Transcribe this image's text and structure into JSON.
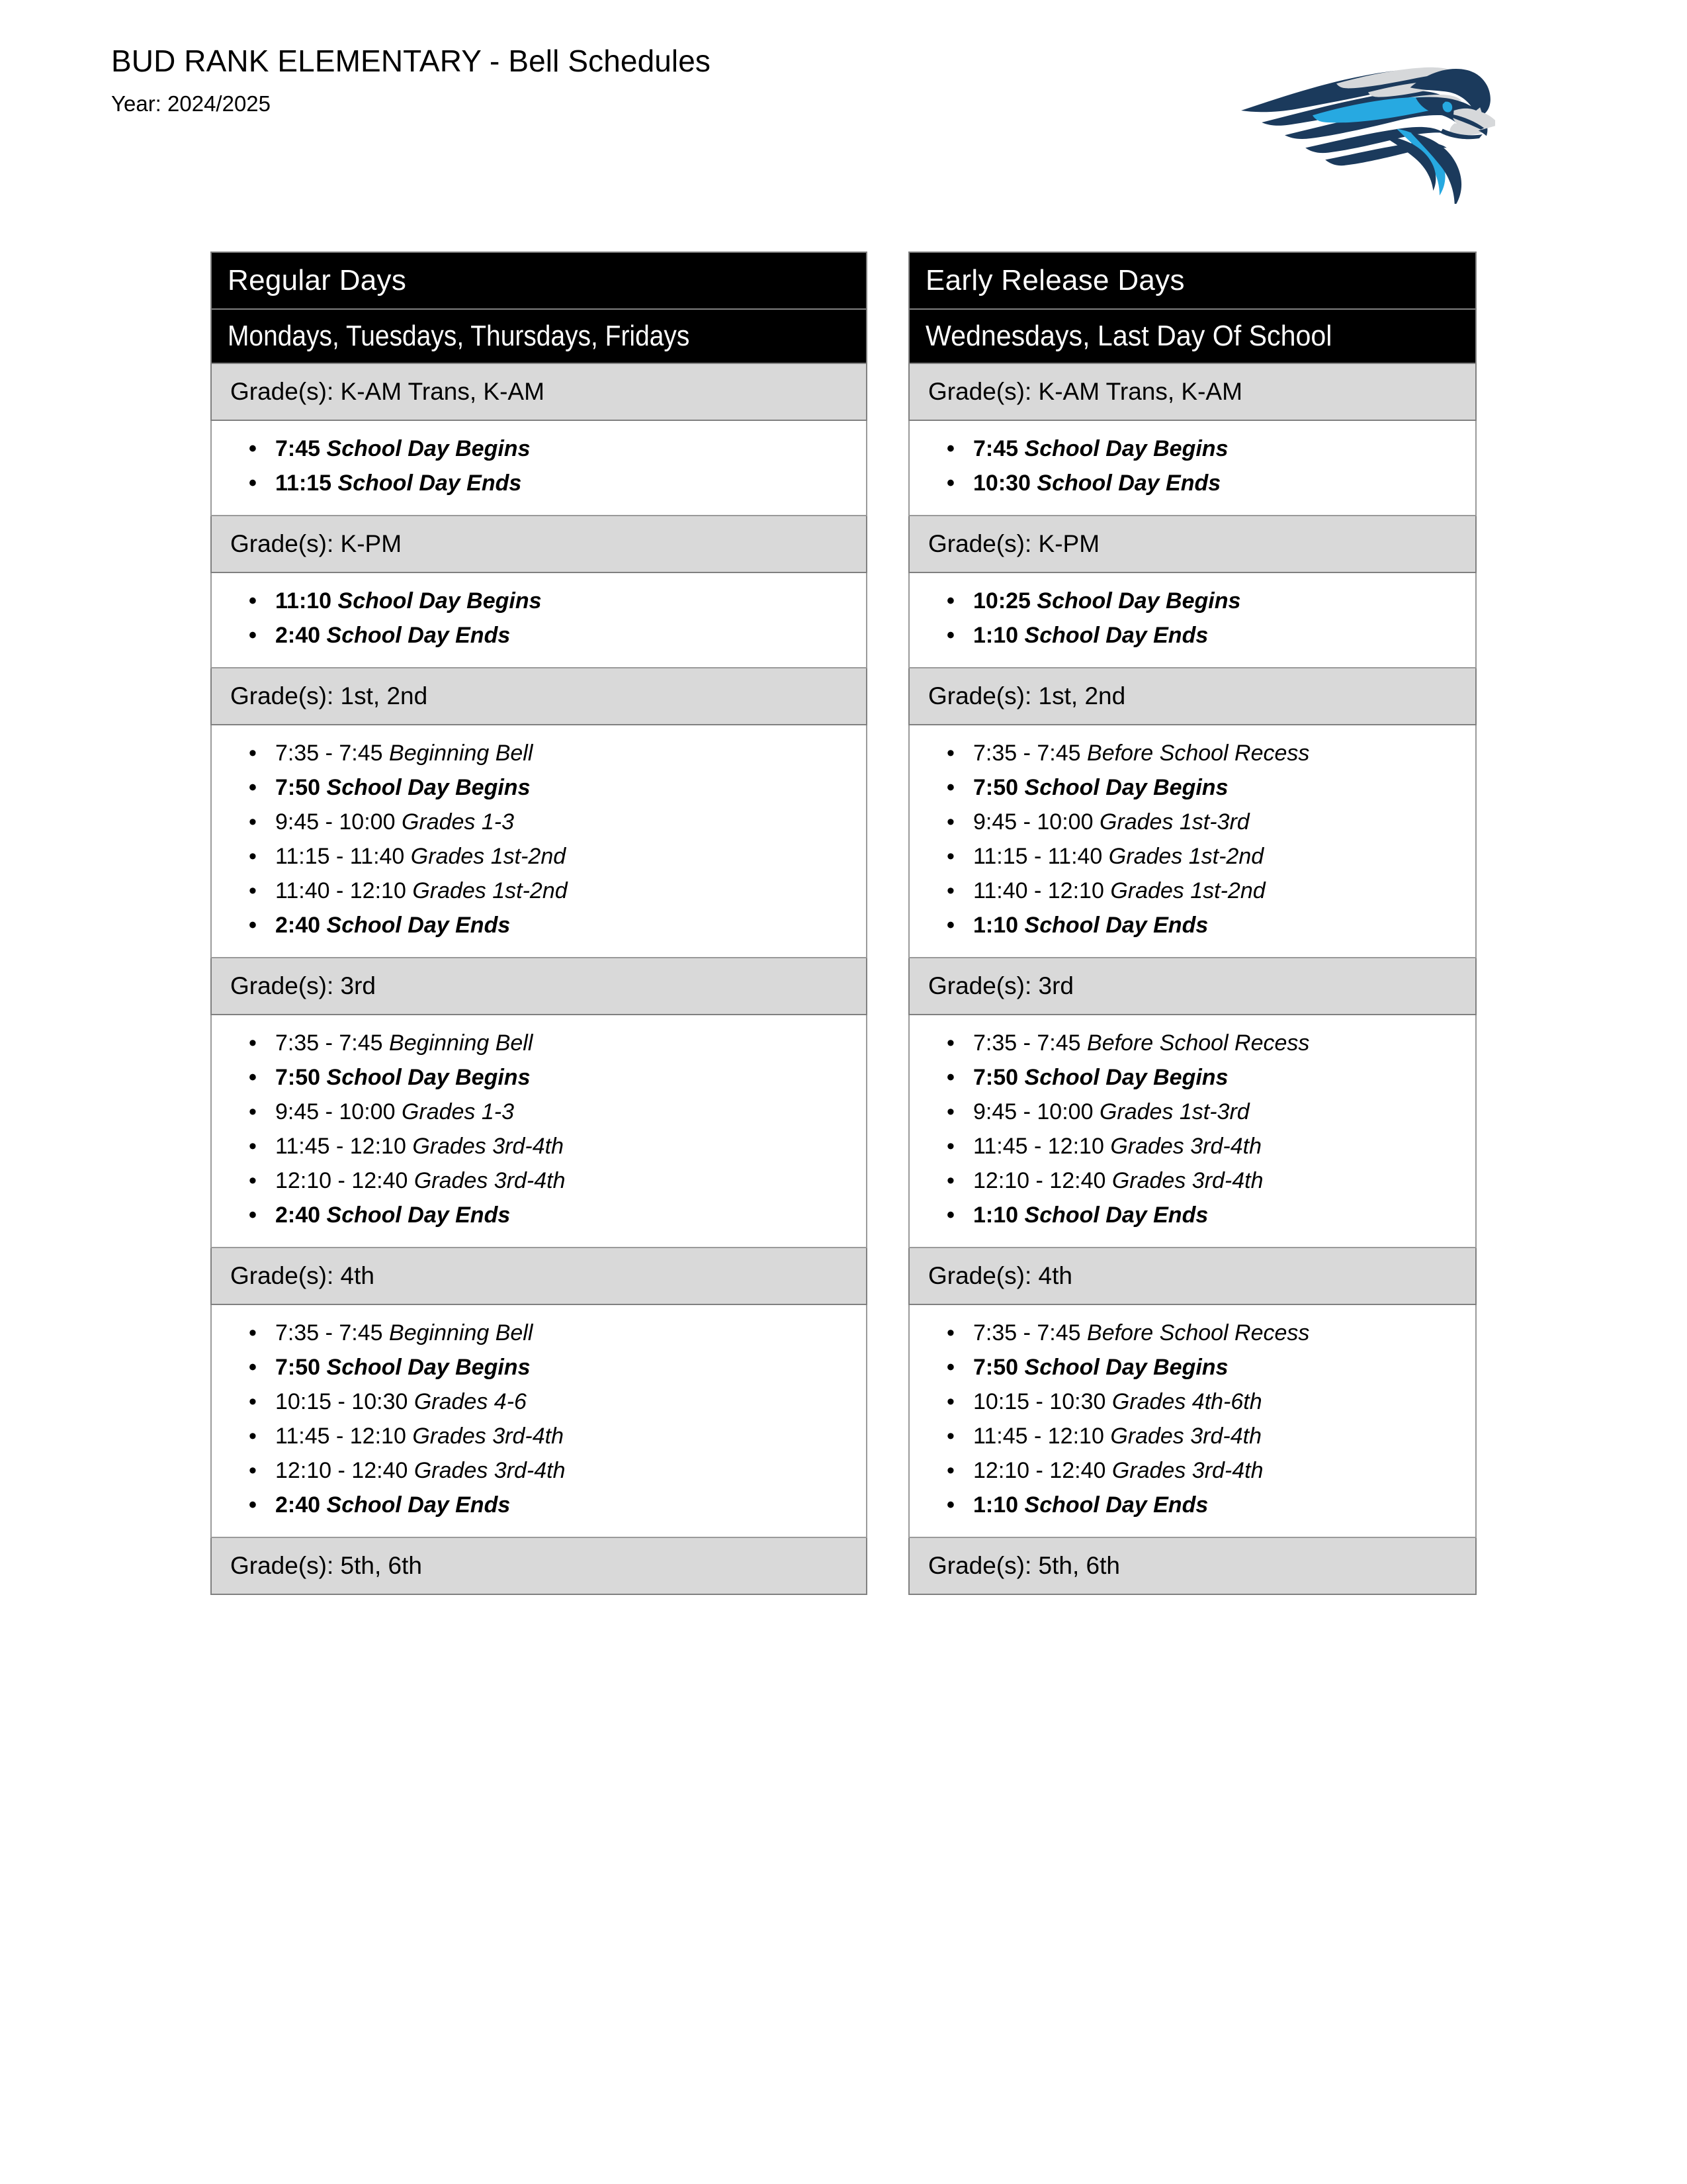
{
  "header": {
    "title": "BUD RANK ELEMENTARY - Bell Schedules",
    "year": "Year: 2024/2025",
    "logo_name": "roadrunner-hawk-head-logo",
    "logo_colors": {
      "navy": "#1B3A5C",
      "cyan": "#27A9E1",
      "gray": "#D6D8DA",
      "eye": "#27A9E1"
    }
  },
  "colors": {
    "band_bg": "#000000",
    "band_text": "#FFFFFF",
    "grade_head_bg": "#D9D9D9",
    "border": "#808080",
    "body_border": "#9A9A9A",
    "page_bg": "#FFFFFF",
    "text": "#000000"
  },
  "schedules": [
    {
      "id": "regular-days",
      "band_primary": "Regular Days",
      "band_secondary": "Mondays, Tuesdays, Thursdays, Fridays",
      "sections": [
        {
          "grade_label": "Grade(s): K-AM Trans, K-AM",
          "entries": [
            {
              "time": "7:45",
              "label": "School Day Begins",
              "bold": true
            },
            {
              "time": "11:15",
              "label": "School Day Ends",
              "bold": true
            }
          ]
        },
        {
          "grade_label": "Grade(s): K-PM",
          "entries": [
            {
              "time": "11:10",
              "label": "School Day Begins",
              "bold": true
            },
            {
              "time": "2:40",
              "label": "School Day Ends",
              "bold": true
            }
          ]
        },
        {
          "grade_label": "Grade(s): 1st, 2nd",
          "entries": [
            {
              "time": "7:35 - 7:45",
              "label": "Beginning Bell",
              "bold": false
            },
            {
              "time": "7:50",
              "label": "School Day Begins",
              "bold": true
            },
            {
              "time": "9:45 - 10:00",
              "label": "Grades 1-3",
              "bold": false
            },
            {
              "time": "11:15 - 11:40",
              "label": "Grades 1st-2nd",
              "bold": false
            },
            {
              "time": "11:40 - 12:10",
              "label": "Grades 1st-2nd",
              "bold": false
            },
            {
              "time": "2:40",
              "label": "School Day Ends",
              "bold": true
            }
          ]
        },
        {
          "grade_label": "Grade(s): 3rd",
          "entries": [
            {
              "time": "7:35 - 7:45",
              "label": "Beginning Bell",
              "bold": false
            },
            {
              "time": "7:50",
              "label": "School Day Begins",
              "bold": true
            },
            {
              "time": "9:45 - 10:00",
              "label": "Grades 1-3",
              "bold": false
            },
            {
              "time": "11:45 - 12:10",
              "label": "Grades 3rd-4th",
              "bold": false
            },
            {
              "time": "12:10 - 12:40",
              "label": "Grades 3rd-4th",
              "bold": false
            },
            {
              "time": "2:40",
              "label": "School Day Ends",
              "bold": true
            }
          ]
        },
        {
          "grade_label": "Grade(s): 4th",
          "entries": [
            {
              "time": "7:35 - 7:45",
              "label": "Beginning Bell",
              "bold": false
            },
            {
              "time": "7:50",
              "label": "School Day Begins",
              "bold": true
            },
            {
              "time": "10:15 - 10:30",
              "label": "Grades 4-6",
              "bold": false
            },
            {
              "time": "11:45 - 12:10",
              "label": "Grades 3rd-4th",
              "bold": false
            },
            {
              "time": "12:10 - 12:40",
              "label": "Grades 3rd-4th",
              "bold": false
            },
            {
              "time": "2:40",
              "label": "School Day Ends",
              "bold": true
            }
          ]
        },
        {
          "grade_label": "Grade(s): 5th, 6th",
          "entries": []
        }
      ]
    },
    {
      "id": "early-release-days",
      "band_primary": "Early Release Days",
      "band_secondary": "Wednesdays, Last Day Of School",
      "sections": [
        {
          "grade_label": "Grade(s): K-AM Trans, K-AM",
          "entries": [
            {
              "time": "7:45",
              "label": "School Day Begins",
              "bold": true
            },
            {
              "time": "10:30",
              "label": "School Day Ends",
              "bold": true
            }
          ]
        },
        {
          "grade_label": "Grade(s): K-PM",
          "entries": [
            {
              "time": "10:25",
              "label": "School Day Begins",
              "bold": true
            },
            {
              "time": "1:10",
              "label": "School Day Ends",
              "bold": true
            }
          ]
        },
        {
          "grade_label": "Grade(s): 1st, 2nd",
          "entries": [
            {
              "time": "7:35 - 7:45",
              "label": "Before School Recess",
              "bold": false
            },
            {
              "time": "7:50",
              "label": "School Day Begins",
              "bold": true
            },
            {
              "time": "9:45 - 10:00",
              "label": "Grades 1st-3rd",
              "bold": false
            },
            {
              "time": "11:15 - 11:40",
              "label": "Grades 1st-2nd",
              "bold": false
            },
            {
              "time": "11:40 - 12:10",
              "label": "Grades 1st-2nd",
              "bold": false
            },
            {
              "time": "1:10",
              "label": "School Day Ends",
              "bold": true
            }
          ]
        },
        {
          "grade_label": "Grade(s): 3rd",
          "entries": [
            {
              "time": "7:35 - 7:45",
              "label": "Before School Recess",
              "bold": false
            },
            {
              "time": "7:50",
              "label": "School Day Begins",
              "bold": true
            },
            {
              "time": "9:45 - 10:00",
              "label": "Grades 1st-3rd",
              "bold": false
            },
            {
              "time": "11:45 - 12:10",
              "label": "Grades 3rd-4th",
              "bold": false
            },
            {
              "time": "12:10 - 12:40",
              "label": "Grades 3rd-4th",
              "bold": false
            },
            {
              "time": "1:10",
              "label": "School Day Ends",
              "bold": true
            }
          ]
        },
        {
          "grade_label": "Grade(s): 4th",
          "entries": [
            {
              "time": "7:35 - 7:45",
              "label": "Before School Recess",
              "bold": false
            },
            {
              "time": "7:50",
              "label": "School Day Begins",
              "bold": true
            },
            {
              "time": "10:15 - 10:30",
              "label": "Grades 4th-6th",
              "bold": false
            },
            {
              "time": "11:45 - 12:10",
              "label": "Grades 3rd-4th",
              "bold": false
            },
            {
              "time": "12:10 - 12:40",
              "label": "Grades 3rd-4th",
              "bold": false
            },
            {
              "time": "1:10",
              "label": "School Day Ends",
              "bold": true
            }
          ]
        },
        {
          "grade_label": "Grade(s): 5th, 6th",
          "entries": []
        }
      ]
    }
  ]
}
